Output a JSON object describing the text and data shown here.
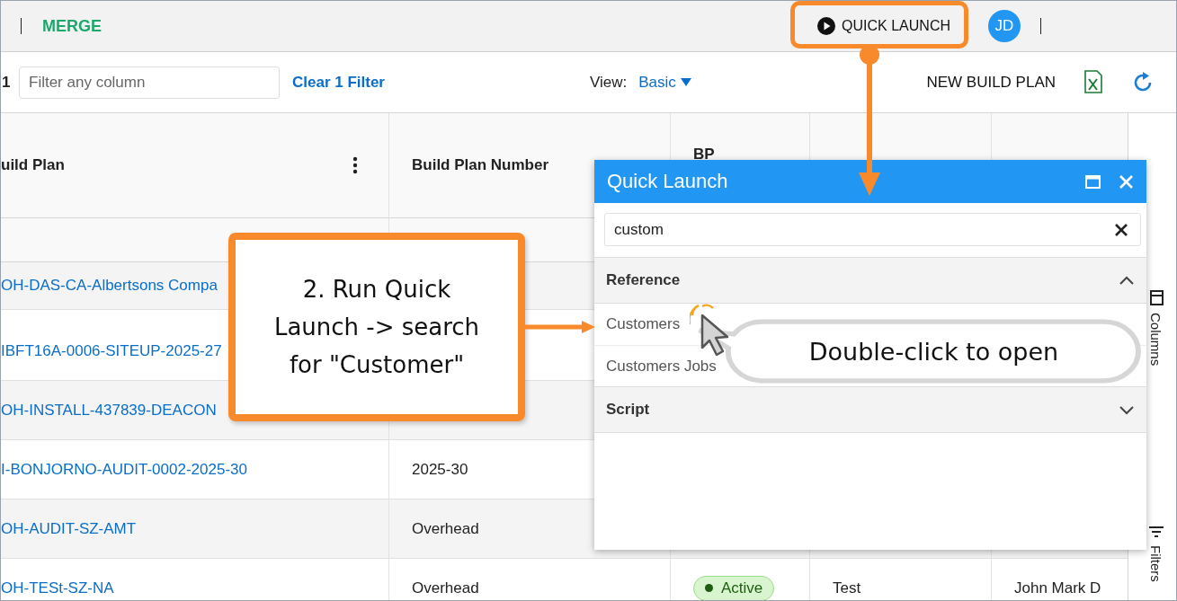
{
  "top_bar": {
    "app_name": "MERGE",
    "quick_launch_button": "QUICK LAUNCH",
    "avatar": "JD"
  },
  "toolbar": {
    "count_fragment": "1",
    "filter": {
      "placeholder": "Filter any column"
    },
    "clear_filter": "Clear 1 Filter",
    "view_label": "View:",
    "view_value": "Basic",
    "new_button": "NEW BUILD PLAN"
  },
  "table": {
    "columns": [
      {
        "label": "uild Plan",
        "menu": true
      },
      {
        "label": "Build Plan Number",
        "menu": false
      },
      {
        "label": "BP",
        "menu": false
      }
    ],
    "rows": [
      {
        "build_plan": "OH-DAS-CA-Albertsons Compa"
      },
      {
        "build_plan": "IBFT16A-0006-SITEUP-2025-27"
      },
      {
        "build_plan": "OH-INSTALL-437839-DEACON"
      },
      {
        "build_plan": "I-BONJORNO-AUDIT-0002-2025-30",
        "build_plan_number": "2025-30"
      },
      {
        "build_plan": "OH-AUDIT-SZ-AMT",
        "build_plan_number": "Overhead"
      },
      {
        "build_plan": "OH-TESt-SZ-NA",
        "build_plan_number": "Overhead",
        "bp": {
          "label": "Active",
          "color": "#1f5c12"
        },
        "column_4": "Test",
        "column_5": "John Mark D"
      }
    ]
  },
  "side_panel": {
    "tabs": [
      "Columns",
      "Filters"
    ]
  },
  "quick_launch": {
    "title": "Quick Launch",
    "search": {
      "value": "custom"
    },
    "groups": [
      {
        "label": "Reference",
        "expanded": true,
        "items": [
          "Customers",
          "Customers Jobs"
        ]
      },
      {
        "label": "Script",
        "expanded": false
      }
    ]
  },
  "annotations": {
    "step_callout": "2. Run Quick Launch -> search for \"Customer\"",
    "hint_bubble": "Double-click to open"
  }
}
